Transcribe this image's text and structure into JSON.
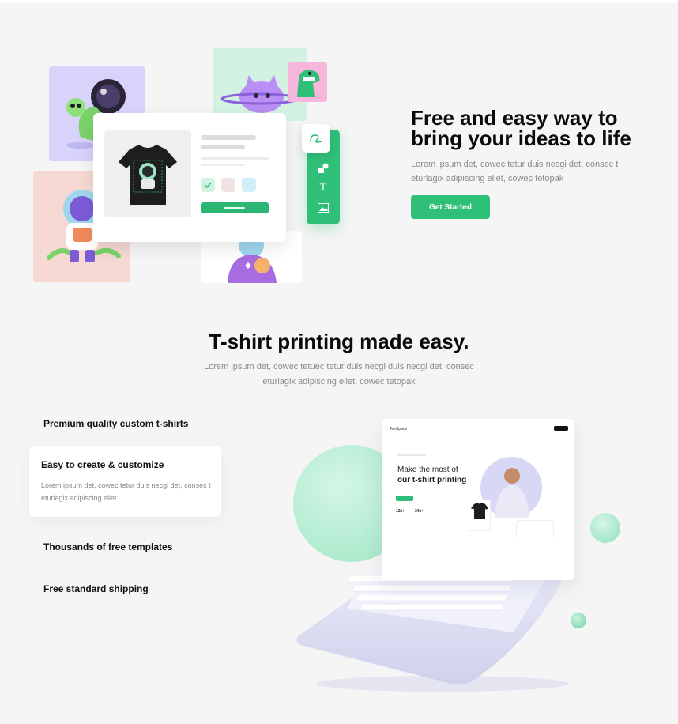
{
  "hero": {
    "title": "Free and easy way to bring your ideas to life",
    "text": "Lorem ipsum det, cowec tetur duis necgi det, consec t eturlagix adipiscing eliet, cowec tetopak",
    "cta_label": "Get Started"
  },
  "section": {
    "title": "T-shirt printing made easy.",
    "text": "Lorem ipsum det, cowec tetuec tetur duis necgi duis necgi det, consec eturlagix adipiscing eliet, cowec tetopak"
  },
  "features": {
    "item1": "Premium quality custom t-shirts",
    "item2_title": "Easy to create & customize",
    "item2_text": "Lorem ipsum det, cowec tetur duis necgi det, consec t eturlagix adipiscing eliet",
    "item3": "Thousands of free templates",
    "item4": "Free standard shipping"
  },
  "laptop_screen": {
    "brand": "TeeSpace",
    "headline_line1": "Make the most of",
    "headline_line2": "our t-shirt printing",
    "stat1": "12k+",
    "stat2": "24k+"
  },
  "icons": {
    "toolbar": [
      "draw-icon",
      "shapes-icon",
      "text-icon",
      "image-icon"
    ]
  },
  "colors": {
    "accent": "#2fbf79",
    "background": "#f5f5f5",
    "heading": "#0b0b0b",
    "muted": "#8a8a8a"
  }
}
